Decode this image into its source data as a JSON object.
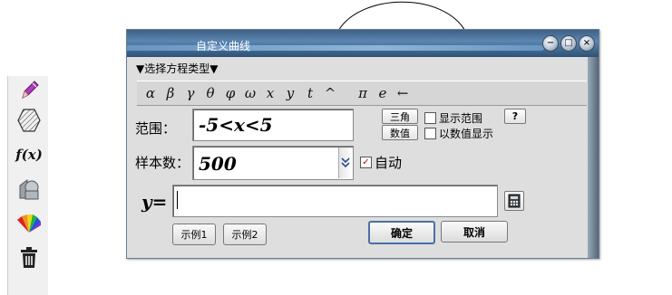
{
  "dialog": {
    "title": "自定义曲线",
    "menu_label": "▼选择方程类型▼",
    "window_buttons": {
      "minimize": "−",
      "maximize": "□",
      "close": "×"
    }
  },
  "symbols": [
    "α",
    "β",
    "γ",
    "θ",
    "φ",
    "ω",
    "x",
    "y",
    "t",
    "^",
    "π",
    "e",
    "←"
  ],
  "range": {
    "label": "范围：",
    "value": "-5<x<5"
  },
  "samples": {
    "label": "样本数：",
    "value": "500"
  },
  "buttons": {
    "trig": "三角",
    "value": "数值",
    "help": "?",
    "example1": "示例1",
    "example2": "示例2",
    "ok": "确定",
    "cancel": "取消"
  },
  "checkboxes": {
    "show_range": {
      "label": "显示范围",
      "checked": false
    },
    "show_as_value": {
      "label": "以数值显示",
      "checked": false
    },
    "auto": {
      "label": "自动",
      "checked": true,
      "mark": "✓"
    }
  },
  "equation": {
    "label": "y=",
    "value": ""
  },
  "toolbar": {
    "items": [
      "pencil-icon",
      "hexagon-icon",
      "fx-icon",
      "3d-shapes-icon",
      "color-fan-icon",
      "trash-icon"
    ],
    "fx_label": "f(x)"
  }
}
